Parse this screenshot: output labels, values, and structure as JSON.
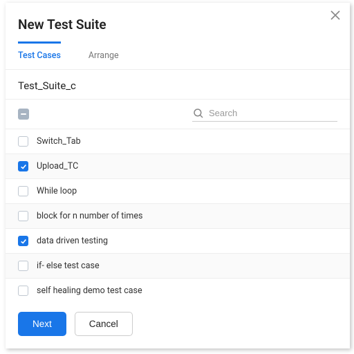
{
  "dialog": {
    "title": "New Test Suite",
    "tabs": [
      {
        "label": "Test Cases",
        "active": true
      },
      {
        "label": "Arrange",
        "active": false
      }
    ],
    "suite_name": "Test_Suite_c",
    "search": {
      "placeholder": "Search",
      "value": ""
    },
    "master_state": "indeterminate",
    "items": [
      {
        "label": "Switch_Tab",
        "checked": false
      },
      {
        "label": "Upload_TC",
        "checked": true
      },
      {
        "label": "While loop",
        "checked": false
      },
      {
        "label": "block for n number of times",
        "checked": false
      },
      {
        "label": "data driven testing",
        "checked": true
      },
      {
        "label": "if- else test case",
        "checked": false
      },
      {
        "label": "self healing demo test case",
        "checked": false
      }
    ],
    "footer": {
      "primary": "Next",
      "secondary": "Cancel"
    }
  }
}
